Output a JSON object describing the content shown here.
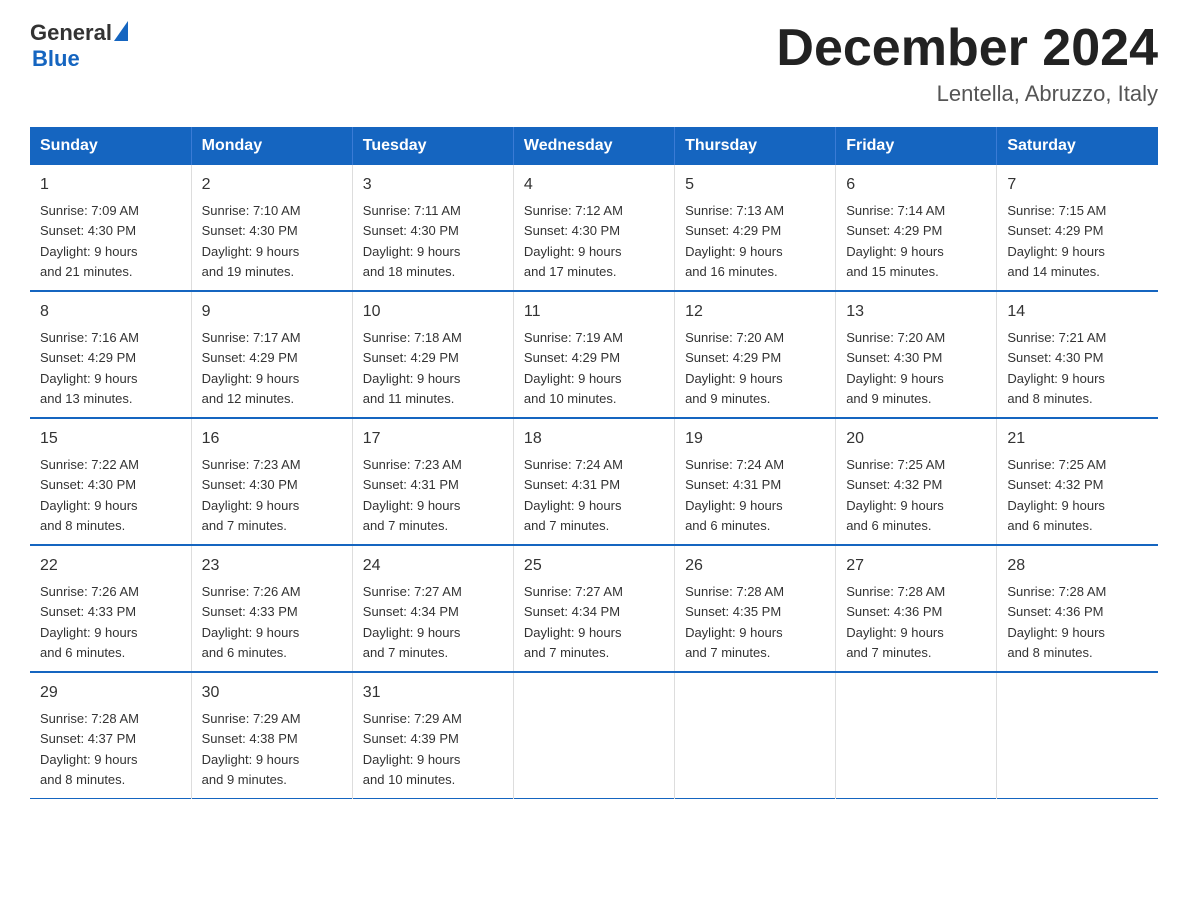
{
  "header": {
    "logo_general": "General",
    "logo_blue": "Blue",
    "main_title": "December 2024",
    "subtitle": "Lentella, Abruzzo, Italy"
  },
  "days_of_week": [
    "Sunday",
    "Monday",
    "Tuesday",
    "Wednesday",
    "Thursday",
    "Friday",
    "Saturday"
  ],
  "weeks": [
    [
      {
        "day": "1",
        "sunrise": "7:09 AM",
        "sunset": "4:30 PM",
        "daylight": "9 hours and 21 minutes."
      },
      {
        "day": "2",
        "sunrise": "7:10 AM",
        "sunset": "4:30 PM",
        "daylight": "9 hours and 19 minutes."
      },
      {
        "day": "3",
        "sunrise": "7:11 AM",
        "sunset": "4:30 PM",
        "daylight": "9 hours and 18 minutes."
      },
      {
        "day": "4",
        "sunrise": "7:12 AM",
        "sunset": "4:30 PM",
        "daylight": "9 hours and 17 minutes."
      },
      {
        "day": "5",
        "sunrise": "7:13 AM",
        "sunset": "4:29 PM",
        "daylight": "9 hours and 16 minutes."
      },
      {
        "day": "6",
        "sunrise": "7:14 AM",
        "sunset": "4:29 PM",
        "daylight": "9 hours and 15 minutes."
      },
      {
        "day": "7",
        "sunrise": "7:15 AM",
        "sunset": "4:29 PM",
        "daylight": "9 hours and 14 minutes."
      }
    ],
    [
      {
        "day": "8",
        "sunrise": "7:16 AM",
        "sunset": "4:29 PM",
        "daylight": "9 hours and 13 minutes."
      },
      {
        "day": "9",
        "sunrise": "7:17 AM",
        "sunset": "4:29 PM",
        "daylight": "9 hours and 12 minutes."
      },
      {
        "day": "10",
        "sunrise": "7:18 AM",
        "sunset": "4:29 PM",
        "daylight": "9 hours and 11 minutes."
      },
      {
        "day": "11",
        "sunrise": "7:19 AM",
        "sunset": "4:29 PM",
        "daylight": "9 hours and 10 minutes."
      },
      {
        "day": "12",
        "sunrise": "7:20 AM",
        "sunset": "4:29 PM",
        "daylight": "9 hours and 9 minutes."
      },
      {
        "day": "13",
        "sunrise": "7:20 AM",
        "sunset": "4:30 PM",
        "daylight": "9 hours and 9 minutes."
      },
      {
        "day": "14",
        "sunrise": "7:21 AM",
        "sunset": "4:30 PM",
        "daylight": "9 hours and 8 minutes."
      }
    ],
    [
      {
        "day": "15",
        "sunrise": "7:22 AM",
        "sunset": "4:30 PM",
        "daylight": "9 hours and 8 minutes."
      },
      {
        "day": "16",
        "sunrise": "7:23 AM",
        "sunset": "4:30 PM",
        "daylight": "9 hours and 7 minutes."
      },
      {
        "day": "17",
        "sunrise": "7:23 AM",
        "sunset": "4:31 PM",
        "daylight": "9 hours and 7 minutes."
      },
      {
        "day": "18",
        "sunrise": "7:24 AM",
        "sunset": "4:31 PM",
        "daylight": "9 hours and 7 minutes."
      },
      {
        "day": "19",
        "sunrise": "7:24 AM",
        "sunset": "4:31 PM",
        "daylight": "9 hours and 6 minutes."
      },
      {
        "day": "20",
        "sunrise": "7:25 AM",
        "sunset": "4:32 PM",
        "daylight": "9 hours and 6 minutes."
      },
      {
        "day": "21",
        "sunrise": "7:25 AM",
        "sunset": "4:32 PM",
        "daylight": "9 hours and 6 minutes."
      }
    ],
    [
      {
        "day": "22",
        "sunrise": "7:26 AM",
        "sunset": "4:33 PM",
        "daylight": "9 hours and 6 minutes."
      },
      {
        "day": "23",
        "sunrise": "7:26 AM",
        "sunset": "4:33 PM",
        "daylight": "9 hours and 6 minutes."
      },
      {
        "day": "24",
        "sunrise": "7:27 AM",
        "sunset": "4:34 PM",
        "daylight": "9 hours and 7 minutes."
      },
      {
        "day": "25",
        "sunrise": "7:27 AM",
        "sunset": "4:34 PM",
        "daylight": "9 hours and 7 minutes."
      },
      {
        "day": "26",
        "sunrise": "7:28 AM",
        "sunset": "4:35 PM",
        "daylight": "9 hours and 7 minutes."
      },
      {
        "day": "27",
        "sunrise": "7:28 AM",
        "sunset": "4:36 PM",
        "daylight": "9 hours and 7 minutes."
      },
      {
        "day": "28",
        "sunrise": "7:28 AM",
        "sunset": "4:36 PM",
        "daylight": "9 hours and 8 minutes."
      }
    ],
    [
      {
        "day": "29",
        "sunrise": "7:28 AM",
        "sunset": "4:37 PM",
        "daylight": "9 hours and 8 minutes."
      },
      {
        "day": "30",
        "sunrise": "7:29 AM",
        "sunset": "4:38 PM",
        "daylight": "9 hours and 9 minutes."
      },
      {
        "day": "31",
        "sunrise": "7:29 AM",
        "sunset": "4:39 PM",
        "daylight": "9 hours and 10 minutes."
      },
      null,
      null,
      null,
      null
    ]
  ],
  "labels": {
    "sunrise": "Sunrise:",
    "sunset": "Sunset:",
    "daylight": "Daylight:"
  }
}
